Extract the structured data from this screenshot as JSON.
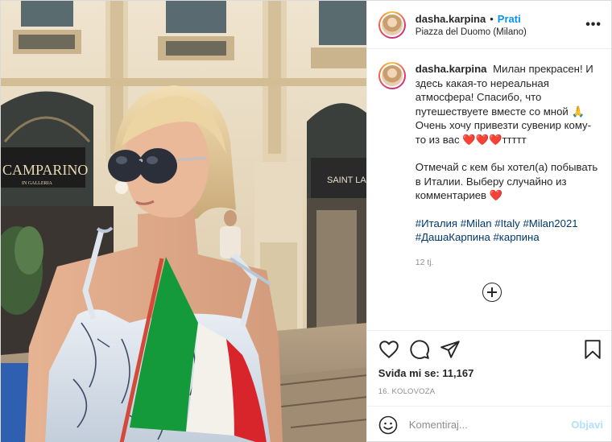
{
  "post": {
    "username": "dasha.karpina",
    "follow_label": "Prati",
    "separator": "•",
    "location": "Piazza del Duomo (Milano)",
    "more_label": "•••"
  },
  "caption": {
    "username": "dasha.karpina",
    "line1": "Милан прекрасен! И здесь какая-то нереальная атмосфера! Спасибо, что путешествуете вместе со мной 🙏",
    "line2_text": "Очень хочу привезти сувенир кому-то из вас",
    "line2_hearts": "❤️❤️❤️",
    "line2_suffix": "ттттт",
    "line3_text": "Отмечай с кем бы хотел(а) побывать в Италии. Выберу случайно из комментариев",
    "line3_heart": "❤️",
    "hashtags_line1": [
      "#Италия",
      "#Milan",
      "#Italy",
      "#Milan2021"
    ],
    "hashtags_line2": [
      "#ДашаКарпина",
      "#карпина"
    ],
    "time_ago": "12 tj."
  },
  "photo": {
    "sign_left": "CAMPARINO",
    "sign_left_sub": "IN GALLERIA",
    "sign_right": "SAINT LAU"
  },
  "actions": {
    "like_icon": "heart-icon",
    "comment_icon": "comment-icon",
    "share_icon": "share-icon",
    "save_icon": "bookmark-icon"
  },
  "likes": {
    "label": "Sviđa mi se: 11,167"
  },
  "date": "16. KOLOVOZA",
  "comment": {
    "placeholder": "Komentiraj...",
    "post_label": "Objavi"
  }
}
